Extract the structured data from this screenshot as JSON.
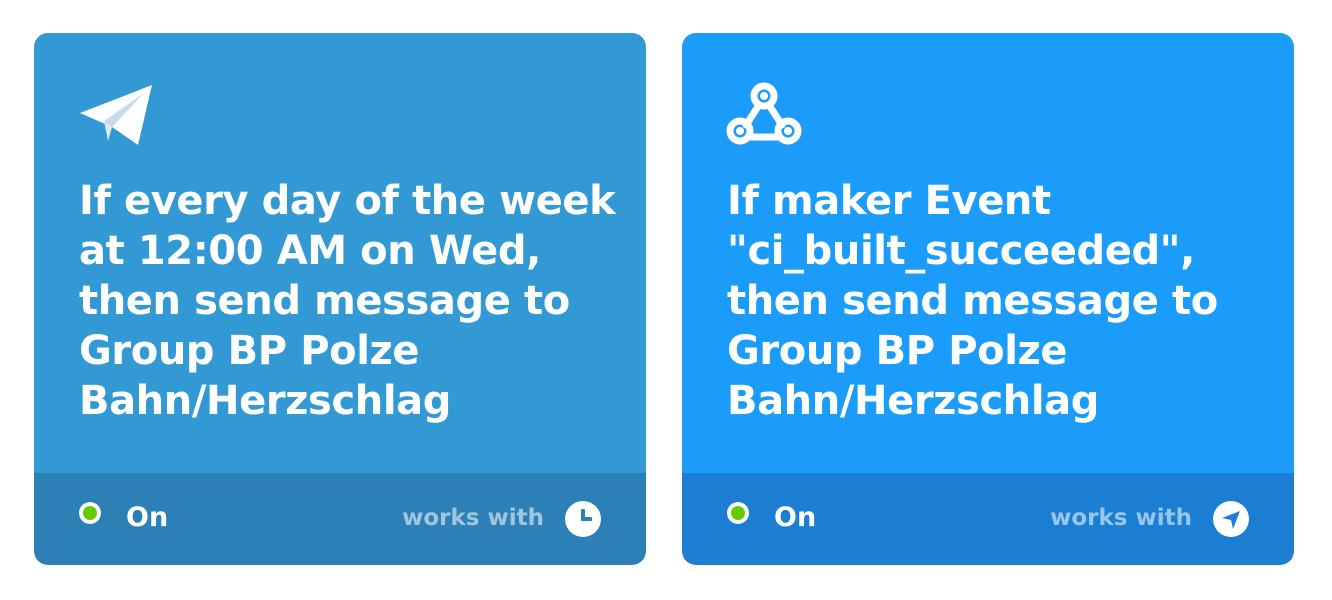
{
  "applets": [
    {
      "service_icon": "telegram-paper-plane-icon",
      "title": "If every day of the week at 12:00 AM on Wed, then send message to Group BP Polze Bahn/Herzschlag",
      "status": "On",
      "works_with_label": "works with",
      "works_with_icon": "date-time-clock-icon",
      "colors": {
        "top": "#3399d4",
        "bottom": "#2d80b6",
        "status": "#66cc00"
      }
    },
    {
      "service_icon": "webhooks-icon",
      "title": "If maker Event \"ci_built_succeeded\", then send message to Group BP Polze Bahn/Herzschlag",
      "status": "On",
      "works_with_label": "works with",
      "works_with_icon": "telegram-paper-plane-icon",
      "colors": {
        "top": "#1c9cfa",
        "bottom": "#1b7ed2",
        "status": "#66cc00"
      }
    }
  ]
}
